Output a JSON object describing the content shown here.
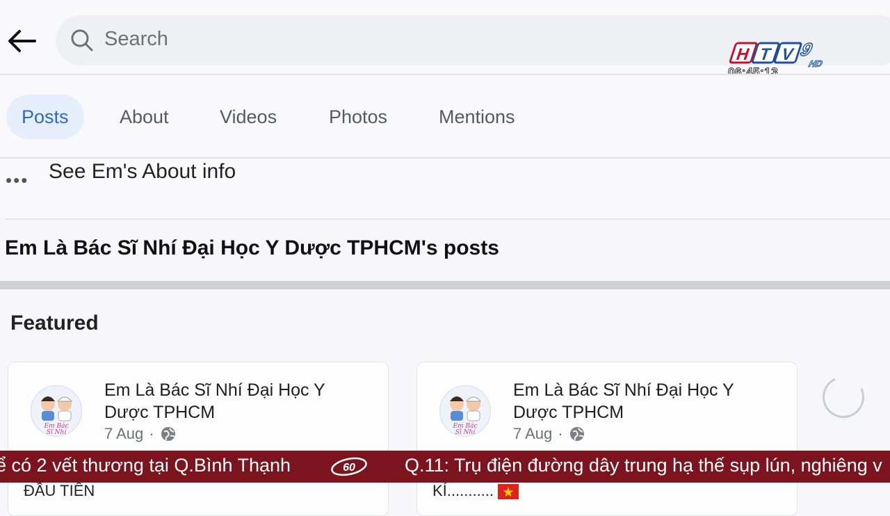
{
  "header": {
    "search_placeholder": "Search"
  },
  "tabs": [
    {
      "label": "Posts",
      "active": true
    },
    {
      "label": "About",
      "active": false
    },
    {
      "label": "Videos",
      "active": false
    },
    {
      "label": "Photos",
      "active": false
    },
    {
      "label": "Mentions",
      "active": false
    }
  ],
  "about_link": "See Em's About info",
  "posts_title": "Em Là Bác Sĩ Nhí Đại Học Y Dược TPHCM's posts",
  "featured_label": "Featured",
  "cards": [
    {
      "name": "Em Là Bác Sĩ Nhí Đại Học Y Dược TPHCM",
      "date": "7 Aug",
      "snippet": "ĐẦU TIÊN"
    },
    {
      "name": "Em Là Bác Sĩ Nhí Đại Học Y Dược TPHCM",
      "date": "7 Aug",
      "snippet": "KÍ..........."
    }
  ],
  "broadcast": {
    "channel": "HTV9",
    "channel_suffix": "HD",
    "time": "06:45:13",
    "ticker_left": "ể có 2 vết thương tại Q.Bình Thạnh",
    "ticker_right": "Q.11: Trụ điện đường dây trung hạ thế sụp lún, nghiêng v",
    "ticker_color": "#7c1420"
  },
  "colors": {
    "accent": "#2d69c9",
    "active_tab_bg": "#e6eefb"
  }
}
